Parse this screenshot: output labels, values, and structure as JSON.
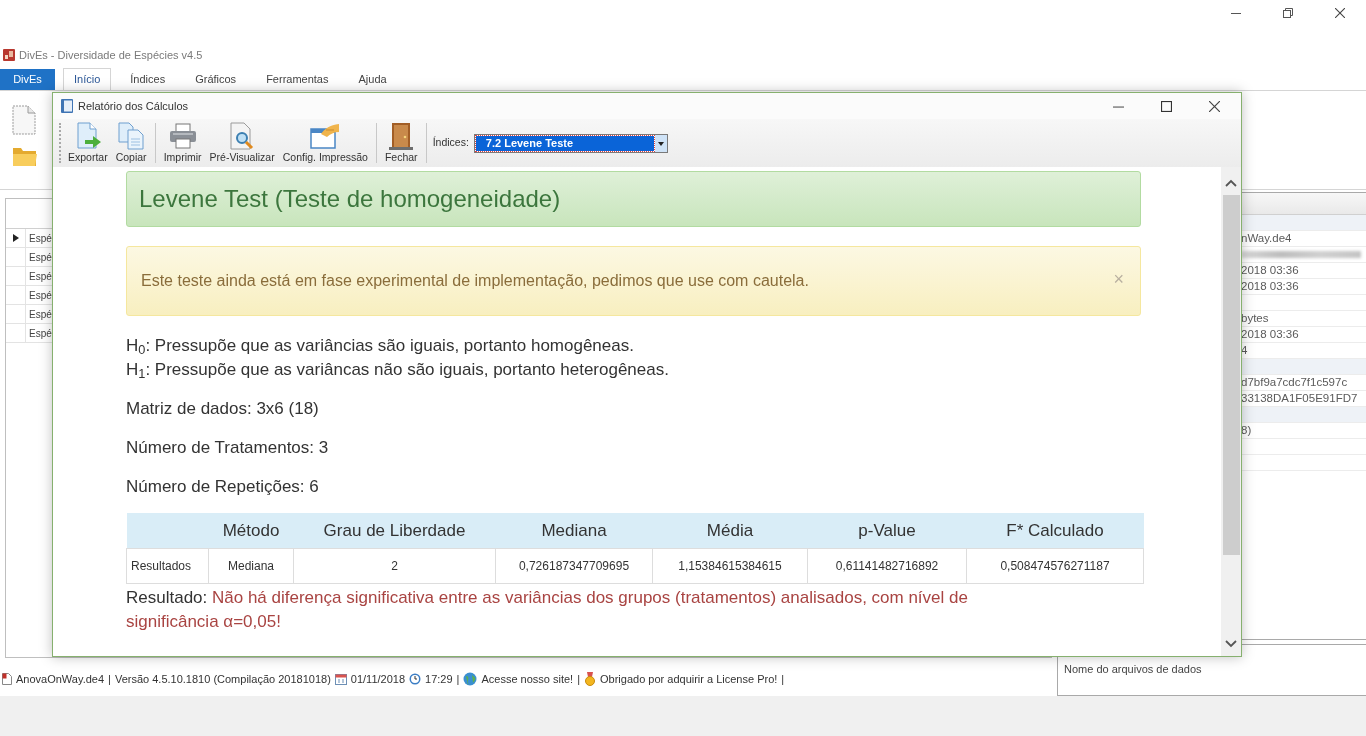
{
  "window": {
    "title": "DivEs - Diversidade de Espécies v4.5"
  },
  "ribbon": {
    "app_button": "DivEs",
    "tabs": [
      {
        "label": "Início",
        "selected": true
      },
      {
        "label": "Índices",
        "selected": false
      },
      {
        "label": "Gráficos",
        "selected": false
      },
      {
        "label": "Ferramentas",
        "selected": false
      },
      {
        "label": "Ajuda",
        "selected": false
      }
    ]
  },
  "species_grid": {
    "rows": [
      {
        "label": "Espé",
        "current": true
      },
      {
        "label": "Espé",
        "current": false
      },
      {
        "label": "Espé",
        "current": false
      },
      {
        "label": "Espé",
        "current": false
      },
      {
        "label": "Espé",
        "current": false
      },
      {
        "label": "Espé",
        "current": false
      }
    ]
  },
  "properties": {
    "rows": [
      {
        "kind": "section"
      },
      {
        "kind": "value",
        "text": "nWay.de4"
      },
      {
        "kind": "redacted"
      },
      {
        "kind": "value",
        "text": "2018 03:36"
      },
      {
        "kind": "value",
        "text": "2018 03:36"
      },
      {
        "kind": "blank"
      },
      {
        "kind": "value",
        "text": "bytes"
      },
      {
        "kind": "value",
        "text": "2018 03:36"
      },
      {
        "kind": "value",
        "text": "4"
      },
      {
        "kind": "section"
      },
      {
        "kind": "value",
        "text": "d7bf9a7cdc7f1c597c"
      },
      {
        "kind": "value",
        "text": "33138DA1F05E91FD7"
      },
      {
        "kind": "section"
      },
      {
        "kind": "value",
        "text": "8)"
      },
      {
        "kind": "blank"
      },
      {
        "kind": "blank"
      }
    ],
    "description": "Nome do arquivos de dados"
  },
  "status_bar": {
    "items": [
      {
        "kind": "file",
        "text": "AnovaOnWay.de4"
      },
      {
        "kind": "separator",
        "text": "|"
      },
      {
        "kind": "text",
        "text": "Versão 4.5.10.1810 (Compilação 20181018)"
      },
      {
        "kind": "date",
        "text": "01/11/2018"
      },
      {
        "kind": "time",
        "text": "17:29"
      },
      {
        "kind": "separator",
        "text": "|"
      },
      {
        "kind": "site_link",
        "text": "Acesse nosso site!"
      },
      {
        "kind": "separator",
        "text": "|"
      },
      {
        "kind": "license_link",
        "text": "Obrigado por adquirir a License Pro!"
      },
      {
        "kind": "separator",
        "text": "|"
      }
    ]
  },
  "report": {
    "title": "Relatório dos Cálculos",
    "toolbar_groups": [
      {
        "buttons": [
          {
            "kind": "export",
            "label": "Exportar"
          },
          {
            "kind": "copy",
            "label": "Copiar"
          }
        ]
      },
      {
        "buttons": [
          {
            "kind": "print",
            "label": "Imprimir"
          },
          {
            "kind": "preview",
            "label": "Pré-Visualizar"
          },
          {
            "kind": "print_setup",
            "label": "Config. Impressão"
          }
        ]
      },
      {
        "buttons": [
          {
            "kind": "close",
            "label": "Fechar"
          }
        ]
      }
    ],
    "index_select": {
      "label": "Índices:",
      "value": "7.2 Levene Teste"
    },
    "heading": "Levene Test (Teste de homogeneidade)",
    "warning": {
      "text": "Este teste ainda está em fase experimental de implementação, pedimos que use com cautela.",
      "close": "×"
    },
    "hypotheses": [
      "H$_{0}$: Pressupõe que as variâncias são iguais, portanto homogêneas.",
      "H$_{1}$: Pressupõe que as variâncas não são iguais, portanto heterogêneas."
    ],
    "facts": [
      "Matriz de dados: 3x6 (18)",
      "Número de Tratamentos: 3",
      "Número de Repetições: 6"
    ],
    "table": {
      "columns": [
        "Método",
        "Grau de Liberdade",
        "Mediana",
        "Média",
        "p-Value",
        "F* Calculado"
      ],
      "rows": [
        {
          "label": "Resultados",
          "cells": [
            "Mediana",
            "2",
            "0,726187347709695",
            "1,15384615384615",
            "0,61141482716892",
            "0,508474576271187"
          ]
        }
      ]
    },
    "result": {
      "label": "Resultado:",
      "message": "Não há diferença significativa entre as variâncias dos grupos (tratamentos) analisados, com nível de significância α=0,05!"
    }
  }
}
